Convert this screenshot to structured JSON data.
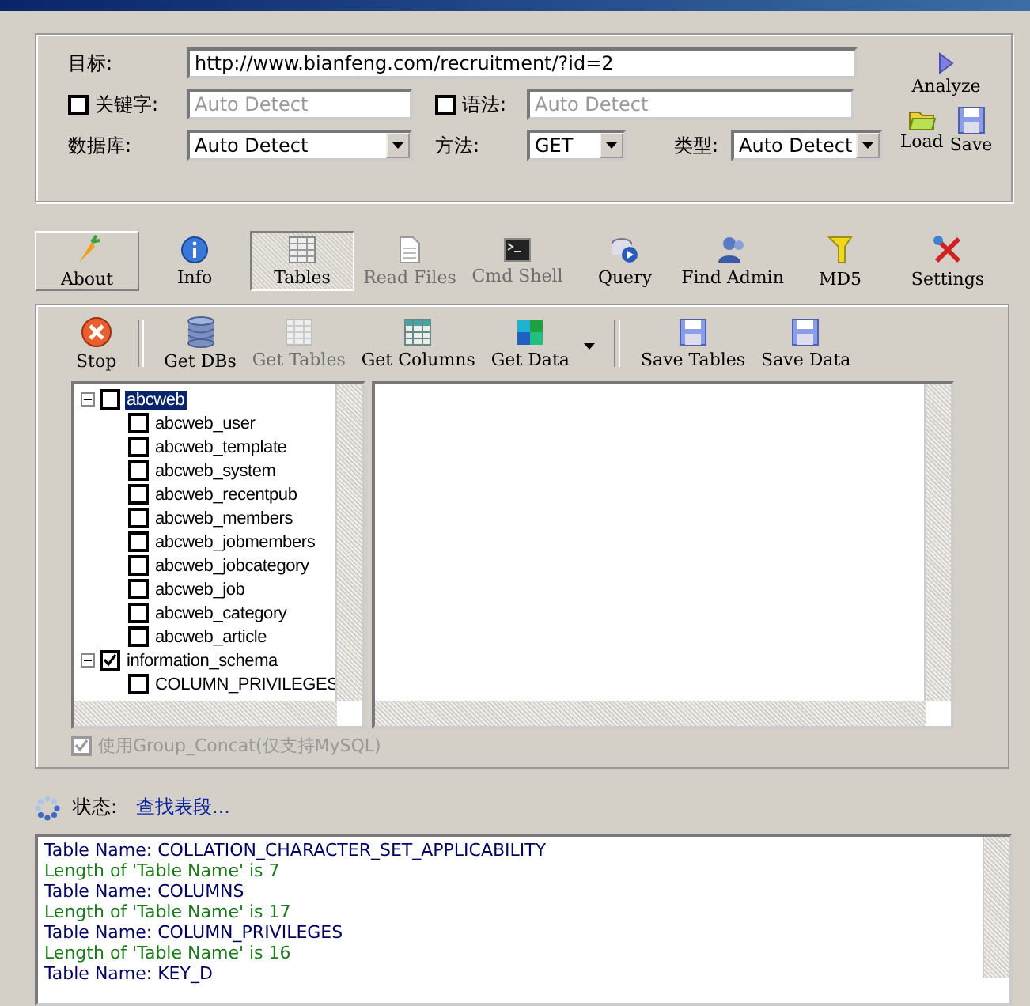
{
  "target": {
    "label": "目标:",
    "value": "http://www.bianfeng.com/recruitment/?id=2"
  },
  "keyword": {
    "label": "关键字:",
    "checked": false,
    "placeholder": "Auto Detect"
  },
  "syntax": {
    "label": "语法:",
    "checked": false,
    "placeholder": "Auto Detect"
  },
  "database": {
    "label": "数据库:",
    "value": "Auto Detect"
  },
  "method": {
    "label": "方法:",
    "value": "GET"
  },
  "type": {
    "label": "类型:",
    "value": "Auto Detect"
  },
  "side_buttons": [
    {
      "label": "Analyze",
      "kind": "analyze"
    },
    {
      "label": "Load",
      "kind": "load"
    },
    {
      "label": "Save",
      "kind": "save"
    }
  ],
  "nav": [
    {
      "label": "About",
      "kind": "about",
      "selected": false,
      "disabled": false,
      "raised": true
    },
    {
      "label": "Info",
      "kind": "info",
      "selected": false,
      "disabled": false,
      "raised": false
    },
    {
      "label": "Tables",
      "kind": "tables",
      "selected": true,
      "disabled": false,
      "raised": false
    },
    {
      "label": "Read Files",
      "kind": "file",
      "selected": false,
      "disabled": true,
      "raised": false
    },
    {
      "label": "Cmd Shell",
      "kind": "shell",
      "selected": false,
      "disabled": true,
      "raised": false
    },
    {
      "label": "Query",
      "kind": "query",
      "selected": false,
      "disabled": false,
      "raised": false
    },
    {
      "label": "Find Admin",
      "kind": "admin",
      "selected": false,
      "disabled": false,
      "raised": false
    },
    {
      "label": "MD5",
      "kind": "md5",
      "selected": false,
      "disabled": false,
      "raised": false
    },
    {
      "label": "Settings",
      "kind": "settings",
      "selected": false,
      "disabled": false,
      "raised": false
    }
  ],
  "toolbar": [
    {
      "label": "Stop",
      "kind": "stop",
      "disabled": false
    },
    {
      "kind": "separator"
    },
    {
      "label": "Get DBs",
      "kind": "dbs",
      "disabled": false
    },
    {
      "label": "Get Tables",
      "kind": "grid",
      "disabled": true
    },
    {
      "label": "Get Columns",
      "kind": "columns",
      "disabled": false
    },
    {
      "label": "Get Data",
      "kind": "data",
      "disabled": false
    },
    {
      "kind": "dropdown"
    },
    {
      "kind": "separator"
    },
    {
      "label": "Save Tables",
      "kind": "save",
      "disabled": false
    },
    {
      "label": "Save Data",
      "kind": "save",
      "disabled": false
    }
  ],
  "tree": [
    {
      "label": "abcweb",
      "checked": false,
      "expanded": true,
      "selected": true,
      "children": [
        {
          "label": "abcweb_user",
          "checked": false
        },
        {
          "label": "abcweb_template",
          "checked": false
        },
        {
          "label": "abcweb_system",
          "checked": false
        },
        {
          "label": "abcweb_recentpub",
          "checked": false
        },
        {
          "label": "abcweb_members",
          "checked": false
        },
        {
          "label": "abcweb_jobmembers",
          "checked": false
        },
        {
          "label": "abcweb_jobcategory",
          "checked": false
        },
        {
          "label": "abcweb_job",
          "checked": false
        },
        {
          "label": "abcweb_category",
          "checked": false
        },
        {
          "label": "abcweb_article",
          "checked": false
        }
      ]
    },
    {
      "label": "information_schema",
      "checked": true,
      "expanded": true,
      "selected": false,
      "children": [
        {
          "label": "COLUMN_PRIVILEGES",
          "checked": false
        }
      ]
    }
  ],
  "group_concat": {
    "label": "使用Group_Concat(仅支持MySQL)",
    "checked": true,
    "disabled": true
  },
  "status": {
    "label": "状态:",
    "value": "查找表段..."
  },
  "log": [
    {
      "text": "Table Name: COLLATION_CHARACTER_SET_APPLICABILITY",
      "kind": "name"
    },
    {
      "text": "Length of 'Table Name' is 7",
      "kind": "length"
    },
    {
      "text": "Table Name: COLUMNS",
      "kind": "name"
    },
    {
      "text": "Length of 'Table Name' is 17",
      "kind": "length"
    },
    {
      "text": "Table Name: COLUMN_PRIVILEGES",
      "kind": "name"
    },
    {
      "text": "Length of 'Table Name' is 16",
      "kind": "length"
    },
    {
      "text": "Table Name: KEY_D",
      "kind": "name"
    }
  ]
}
